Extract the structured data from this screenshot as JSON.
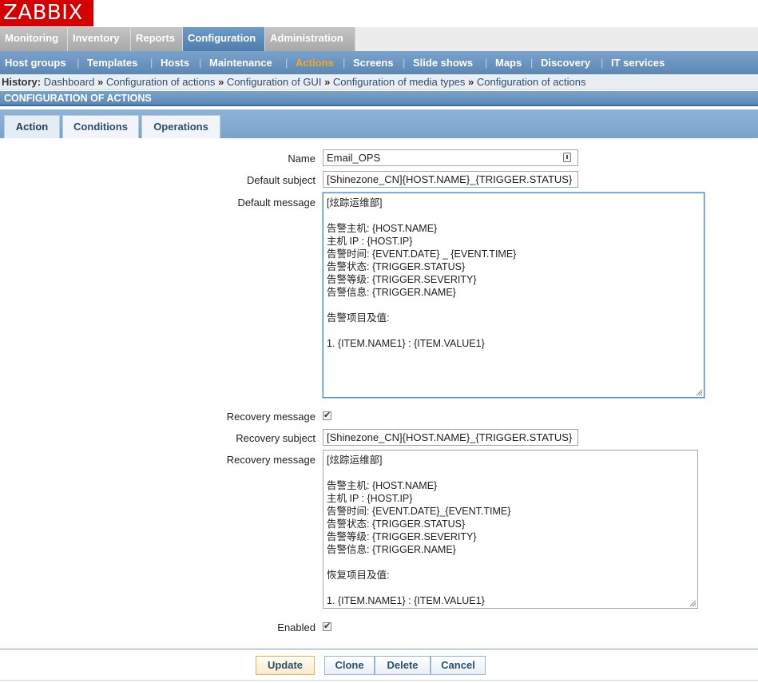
{
  "logo": "ZABBIX",
  "main_nav": [
    "Monitoring",
    "Inventory",
    "Reports",
    "Configuration",
    "Administration"
  ],
  "main_nav_active": "Configuration",
  "sub_nav": [
    "Host groups",
    "Templates",
    "Hosts",
    "Maintenance",
    "Actions",
    "Screens",
    "Slide shows",
    "Maps",
    "Discovery",
    "IT services"
  ],
  "sub_nav_active": "Actions",
  "sub_nav_sep": "|",
  "history": {
    "label": "History:",
    "links": [
      "Dashboard",
      "Configuration of actions",
      "Configuration of GUI",
      "Configuration of media types",
      "Configuration of actions"
    ],
    "sep": "»"
  },
  "section_title": "CONFIGURATION OF ACTIONS",
  "form_tabs": [
    "Action",
    "Conditions",
    "Operations"
  ],
  "form_tab_active": "Action",
  "form": {
    "name_label": "Name",
    "name_value": "Email_OPS",
    "default_subject_label": "Default subject",
    "default_subject_value": "[Shinezone_CN]{HOST.NAME}_{TRIGGER.STATUS}",
    "default_message_label": "Default message",
    "default_message_value": "[炫踪运维部]\n\n告警主机: {HOST.NAME}\n主机 IP : {HOST.IP}\n告警时间: {EVENT.DATE} _ {EVENT.TIME}\n告警状态: {TRIGGER.STATUS}\n告警等级: {TRIGGER.SEVERITY}\n告警信息: {TRIGGER.NAME}\n\n告警项目及值:\n\n1. {ITEM.NAME1} : {ITEM.VALUE1}",
    "recovery_checkbox_label": "Recovery message",
    "recovery_subject_label": "Recovery subject",
    "recovery_subject_value": "[Shinezone_CN]{HOST.NAME}_{TRIGGER.STATUS}",
    "recovery_message_label": "Recovery message",
    "recovery_message_value": "[炫踪运维部]\n\n告警主机: {HOST.NAME}\n主机 IP : {HOST.IP}\n告警时间: {EVENT.DATE}_{EVENT.TIME}\n告警状态: {TRIGGER.STATUS}\n告警等级: {TRIGGER.SEVERITY}\n告警信息: {TRIGGER.NAME}\n\n恢复项目及值:\n\n1. {ITEM.NAME1} : {ITEM.VALUE1}",
    "enabled_label": "Enabled"
  },
  "buttons": {
    "update": "Update",
    "clone": "Clone",
    "delete": "Delete",
    "cancel": "Cancel"
  },
  "colors": {
    "logo_red": "#d40000",
    "nav_blue": "#5d87b5",
    "active_orange": "#f5a623"
  }
}
